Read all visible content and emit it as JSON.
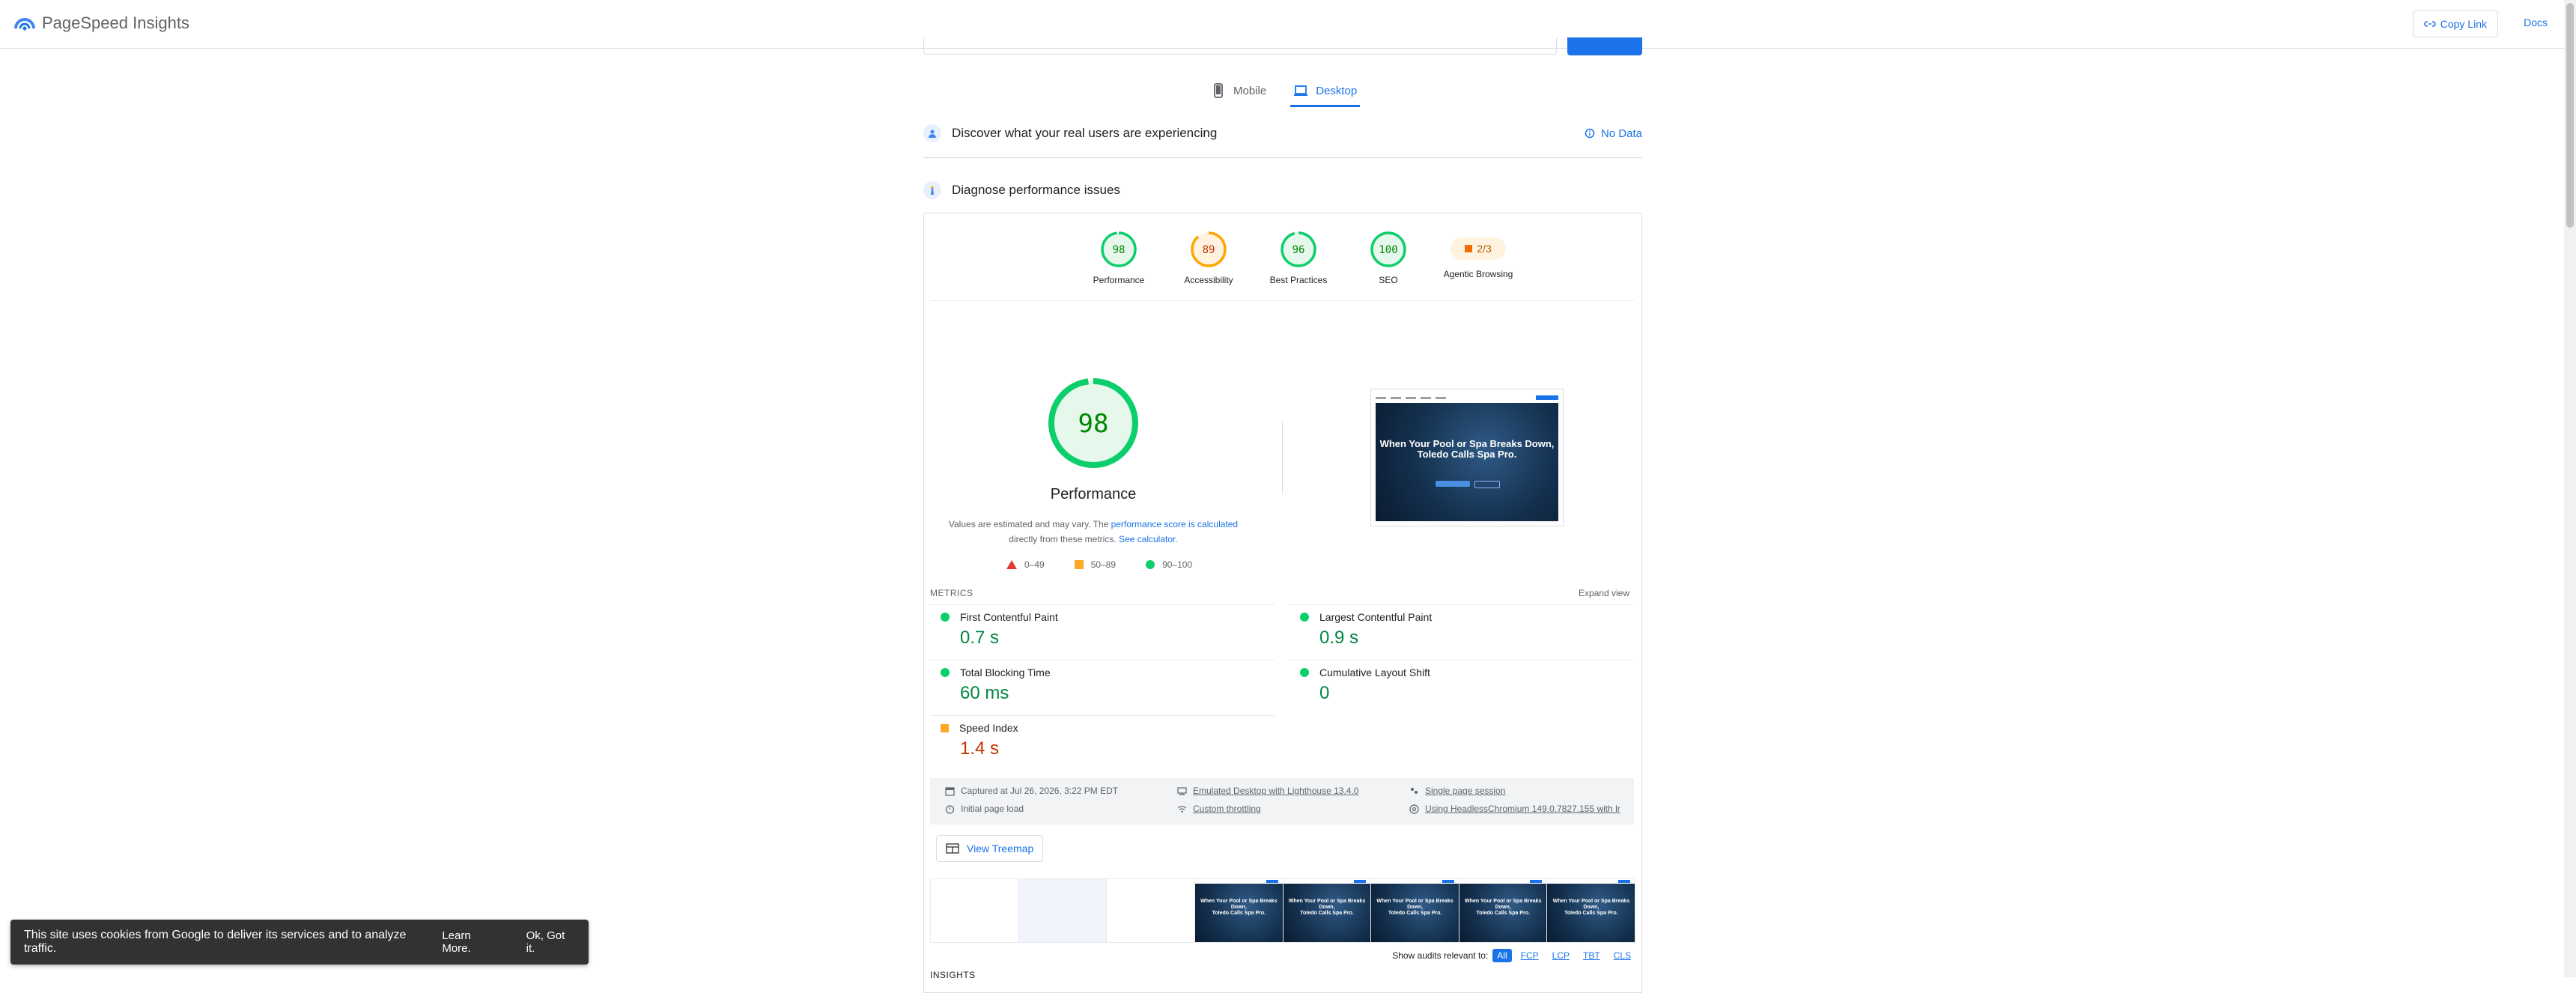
{
  "header": {
    "app_title": "PageSpeed Insights",
    "copy_link": "Copy Link",
    "docs": "Docs"
  },
  "device_tabs": [
    {
      "label": "Mobile",
      "active": false
    },
    {
      "label": "Desktop",
      "active": true
    }
  ],
  "field_data": {
    "title": "Discover what your real users are experiencing",
    "status": "No Data"
  },
  "diagnose": {
    "title": "Diagnose performance issues"
  },
  "category_scores": [
    {
      "score": "98",
      "label": "Performance",
      "value": 0.98,
      "color": "#0cce6b"
    },
    {
      "score": "89",
      "label": "Accessibility",
      "value": 0.89,
      "color": "#ffa400"
    },
    {
      "score": "96",
      "label": "Best Practices",
      "value": 0.96,
      "color": "#0cce6b"
    },
    {
      "score": "100",
      "label": "SEO",
      "value": 1.0,
      "color": "#0cce6b"
    }
  ],
  "agentic": {
    "score": "2/3",
    "label": "Agentic Browsing"
  },
  "performance": {
    "score": "98",
    "value": 0.98,
    "title": "Performance",
    "note_prefix": "Values are estimated and may vary. The ",
    "note_link1": "performance score is calculated",
    "note_middle": " directly from these metrics. ",
    "note_link2": "See calculator."
  },
  "legend": [
    "0–49",
    "50–89",
    "90–100"
  ],
  "screenshot": {
    "headline_line1": "When Your Pool or Spa Breaks Down,",
    "headline_line2": "Toledo Calls Spa Pro."
  },
  "metrics": {
    "header": "METRICS",
    "expand": "Expand view",
    "items": [
      {
        "label": "First Contentful Paint",
        "value": "0.7 s",
        "rating": "good"
      },
      {
        "label": "Largest Contentful Paint",
        "value": "0.9 s",
        "rating": "good"
      },
      {
        "label": "Total Blocking Time",
        "value": "60 ms",
        "rating": "good"
      },
      {
        "label": "Cumulative Layout Shift",
        "value": "0",
        "rating": "good"
      },
      {
        "label": "Speed Index",
        "value": "1.4 s",
        "rating": "average"
      }
    ]
  },
  "runtime": {
    "captured": "Captured at Jul 26, 2026, 3:22 PM EDT",
    "initial_load": "Initial page load",
    "emulated": "Emulated Desktop with Lighthouse 13.4.0",
    "throttling": "Custom throttling",
    "session": "Single page session",
    "browser": "Using HeadlessChromium 149.0.7827.155 with lr"
  },
  "treemap": "View Treemap",
  "audit_filter": {
    "label": "Show audits relevant to:",
    "chips": [
      "All",
      "FCP",
      "LCP",
      "TBT",
      "CLS"
    ]
  },
  "insights": "INSIGHTS",
  "cookie": {
    "text": "This site uses cookies from Google to deliver its services and to analyze traffic.",
    "learn_more": "Learn More.",
    "ok": "Ok, Got it."
  }
}
